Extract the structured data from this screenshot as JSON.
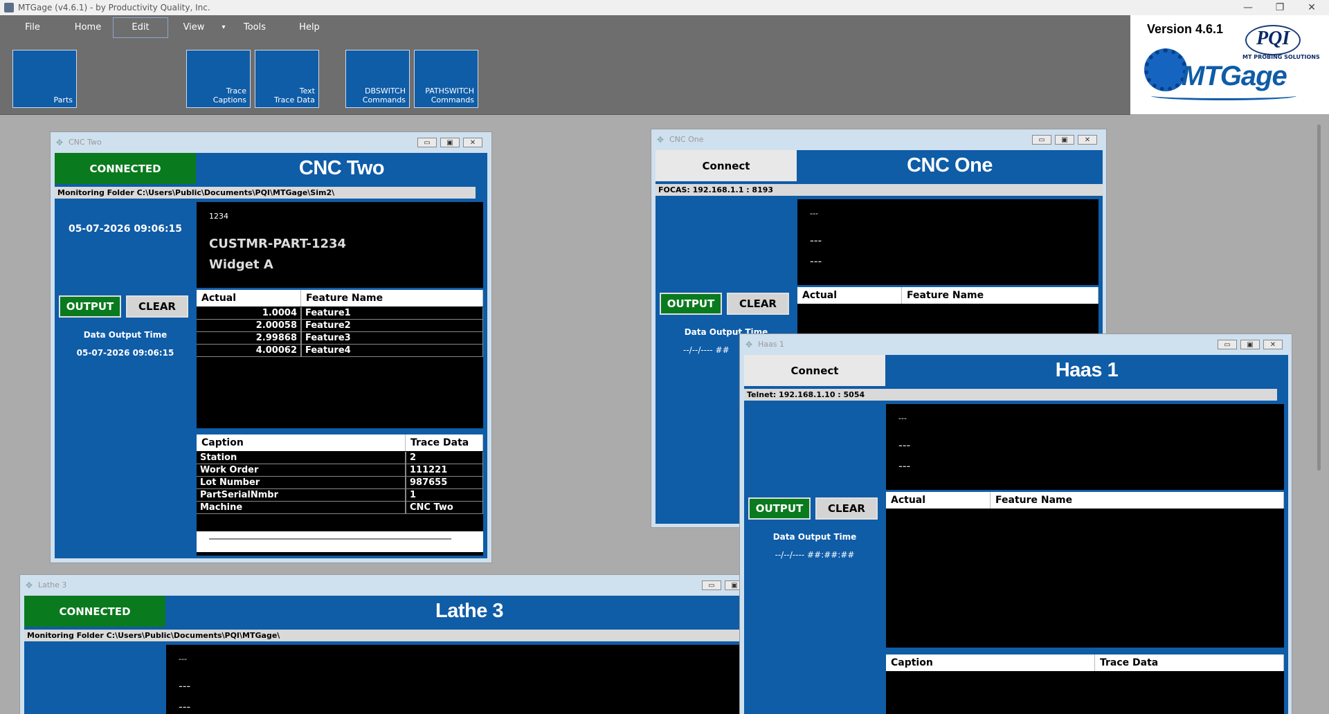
{
  "app": {
    "title": "MTGage (v4.6.1) - by Productivity Quality, Inc.",
    "controls": {
      "minimize": "—",
      "restore": "❐",
      "close": "✕"
    }
  },
  "menu": [
    {
      "label": "File"
    },
    {
      "label": "Home"
    },
    {
      "label": "Edit"
    },
    {
      "label": "View"
    },
    {
      "label": "▾"
    },
    {
      "label": "Tools"
    },
    {
      "label": "Help"
    }
  ],
  "ribbon": [
    {
      "label": "Parts"
    },
    {
      "label": "Trace\nCaptions"
    },
    {
      "label": "Text\nTrace Data"
    },
    {
      "label": "DBSWITCH\nCommands"
    },
    {
      "label": "PATHSWITCH\nCommands"
    }
  ],
  "logo": {
    "version": "Version 4.6.1",
    "pqi": "PQI",
    "tagline": "MT PROBING SOLUTIONS",
    "brand": "MTGage"
  },
  "colors": {
    "accent": "#0f5ca7",
    "connected": "#0a7a1e",
    "background": "#ababab"
  },
  "cnc_two": {
    "window_title": "CNC Two",
    "status": "CONNECTED",
    "title": "CNC Two",
    "info": "Monitoring Folder C:\\Users\\Public\\Documents\\PQI\\MTGage\\Sim2\\",
    "datetime": "05-07-2026 09:06:15",
    "part_number": "1234",
    "part_name": "CUSTMR-PART-1234",
    "description": "Widget A",
    "output_label": "OUTPUT",
    "clear_label": "CLEAR",
    "output_time_label": "Data Output Time",
    "output_time": "05-07-2026 09:06:15",
    "features_header": [
      "Actual",
      "Feature Name"
    ],
    "features": [
      {
        "actual": "1.0004",
        "name": "Feature1"
      },
      {
        "actual": "2.00058",
        "name": "Feature2"
      },
      {
        "actual": "2.99868",
        "name": "Feature3"
      },
      {
        "actual": "4.00062",
        "name": "Feature4"
      }
    ],
    "trace_header": [
      "Caption",
      "Trace Data"
    ],
    "trace": [
      {
        "caption": "Station",
        "value": "2"
      },
      {
        "caption": "Work Order",
        "value": "111221"
      },
      {
        "caption": "Lot Number",
        "value": "987655"
      },
      {
        "caption": "PartSerialNmbr",
        "value": "1"
      },
      {
        "caption": "Machine",
        "value": "CNC Two"
      }
    ]
  },
  "cnc_one": {
    "window_title": "CNC One",
    "status": "Connect",
    "title": "CNC One",
    "info": "FOCAS: 192.168.1.1 : 8193",
    "part_number": "---",
    "part_name": "---",
    "description": "---",
    "output_label": "OUTPUT",
    "clear_label": "CLEAR",
    "output_time_label": "Data Output Time",
    "output_time": "--/--/---- ##",
    "features_header": [
      "Actual",
      "Feature Name"
    ]
  },
  "haas_1": {
    "window_title": "Haas 1",
    "status": "Connect",
    "title": "Haas 1",
    "info": "Telnet: 192.168.1.10 : 5054",
    "part_number": "---",
    "part_name": "---",
    "description": "---",
    "output_label": "OUTPUT",
    "clear_label": "CLEAR",
    "output_time_label": "Data Output Time",
    "output_time": "--/--/---- ##:##:##",
    "features_header": [
      "Actual",
      "Feature Name"
    ],
    "trace_header": [
      "Caption",
      "Trace Data"
    ]
  },
  "lathe_3": {
    "window_title": "Lathe 3",
    "status": "CONNECTED",
    "title": "Lathe 3",
    "info": "Monitoring Folder C:\\Users\\Public\\Documents\\PQI\\MTGage\\",
    "part_number": "---",
    "part_name": "---",
    "description": "---"
  }
}
